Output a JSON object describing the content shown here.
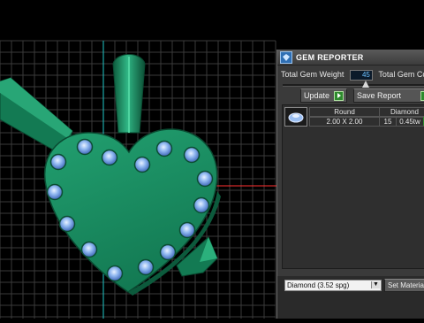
{
  "viewport": {
    "colors": {
      "background": "#000000",
      "grid": "#3a3a3a",
      "metal": "#1a8a62",
      "metal_dark": "#0e5b3e",
      "gem": "#8fb7f0",
      "axis_red": "#ff3030",
      "axis_cyan": "#20c8c8"
    }
  },
  "panel": {
    "title": "GEM REPORTER",
    "icon": "gem-reporter-icon",
    "total_weight_label": "Total Gem Weight",
    "total_weight_value": "45",
    "total_count_label": "Total Gem Count",
    "update_label": "Update",
    "save_report_label": "Save Report",
    "table": {
      "headers": [
        "Round",
        "Diamond"
      ],
      "rows": [
        {
          "size": "2.00 X 2.00",
          "count": "15",
          "weight": "0.45tw"
        }
      ]
    },
    "material_select": "Diamond   (3.52 spg)",
    "set_material_label": "Set Material"
  }
}
